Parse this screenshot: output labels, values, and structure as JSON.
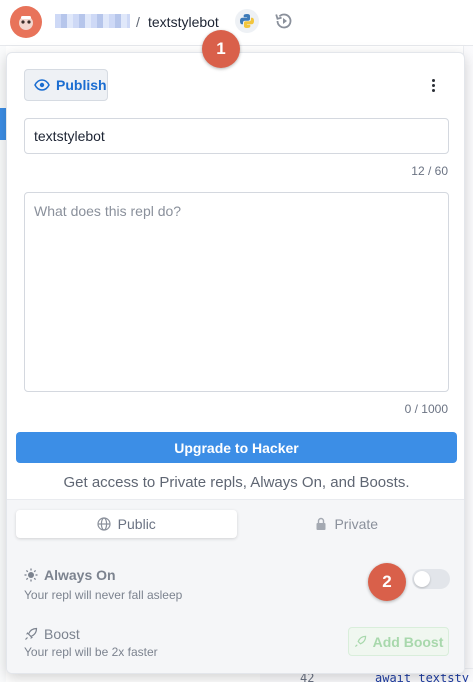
{
  "header": {
    "repl_name": "textstylebot",
    "separator": "/",
    "language_icon": "python-icon",
    "history_icon": "history-icon"
  },
  "publish": {
    "button_label": "Publish",
    "more_icon": "more-vertical-icon"
  },
  "form": {
    "name_value": "textstylebot",
    "name_count": "12 / 60",
    "description_placeholder": "What does this repl do?",
    "description_count": "0 / 1000"
  },
  "upgrade": {
    "button_label": "Upgrade to Hacker",
    "subtitle": "Get access to Private repls, Always On, and Boosts."
  },
  "visibility": {
    "public_label": "Public",
    "private_label": "Private",
    "selected": "Public"
  },
  "always_on": {
    "title": "Always On",
    "subtitle": "Your repl will never fall asleep",
    "enabled": false
  },
  "boost": {
    "title": "Boost",
    "subtitle": "Your repl will be 2x faster",
    "button_label": "Add Boost"
  },
  "markers": {
    "one": "1",
    "two": "2"
  },
  "background_editor": {
    "line_number": "42",
    "code": "await textsty"
  },
  "colors": {
    "accent": "#3c8ee6",
    "publish_text": "#1a6dd1",
    "marker": "#d9604a",
    "avatar": "#e8735a"
  }
}
